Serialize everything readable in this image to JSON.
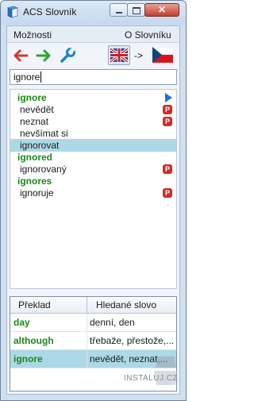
{
  "window": {
    "title": "ACS Slovník",
    "close_glyph": "✕"
  },
  "menu": {
    "options": "Možnosti",
    "about": "O Slovníku"
  },
  "toolbar": {
    "back_icon": "arrow-left-icon",
    "forward_icon": "arrow-right-icon",
    "settings_icon": "wrench-icon",
    "source_flag": "uk-flag-icon",
    "direction": "->",
    "target_flag": "cz-flag-icon"
  },
  "search": {
    "value": "ignore"
  },
  "results": [
    {
      "type": "word",
      "text": "ignore",
      "icon": "play"
    },
    {
      "type": "trans",
      "text": "nevědět",
      "icon": "P"
    },
    {
      "type": "trans",
      "text": "neznat",
      "icon": "P"
    },
    {
      "type": "trans",
      "text": "nevšímat si",
      "icon": ""
    },
    {
      "type": "trans",
      "text": "ignorovat",
      "icon": "",
      "selected": true
    },
    {
      "type": "word",
      "text": "ignored",
      "icon": ""
    },
    {
      "type": "trans",
      "text": "ignorovaný",
      "icon": "P"
    },
    {
      "type": "word",
      "text": "ignores",
      "icon": ""
    },
    {
      "type": "trans",
      "text": "ignoruje",
      "icon": "P"
    }
  ],
  "history": {
    "col_translation": "Překlad",
    "col_searched": "Hledané slovo",
    "rows": [
      {
        "word": "day",
        "trans": "denní, den"
      },
      {
        "word": "although",
        "trans": "třebaže, přestože,..."
      },
      {
        "word": "ignore",
        "trans": "nevědět, neznat,...",
        "selected": true
      }
    ]
  },
  "watermark": "INSTALUJ.CZ",
  "colors": {
    "accent_green": "#188a18",
    "selection": "#add8e6",
    "badge_red": "#d42a2a"
  }
}
